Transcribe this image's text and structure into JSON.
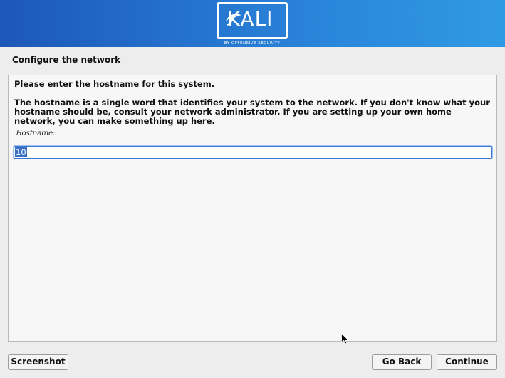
{
  "banner": {
    "logo_text": "KALI",
    "logo_subtitle": "BY OFFENSIVE SECURITY",
    "logo_icon": "kali-dragon-icon"
  },
  "page": {
    "title": "Configure the network"
  },
  "panel": {
    "prompt": "Please enter the hostname for this system.",
    "description": "The hostname is a single word that identifies your system to the network. If you don't know what your hostname should be, consult your network administrator. If you are setting up your own home network, you can make something up here.",
    "field_label": "Hostname:",
    "field_value": "10"
  },
  "buttons": {
    "screenshot": "Screenshot",
    "go_back": "Go Back",
    "continue": "Continue"
  },
  "colors": {
    "banner_left": "#1d57b8",
    "banner_right": "#2f9ae4",
    "selection": "#3a6fc7",
    "focus_border": "#3d7ad6"
  }
}
